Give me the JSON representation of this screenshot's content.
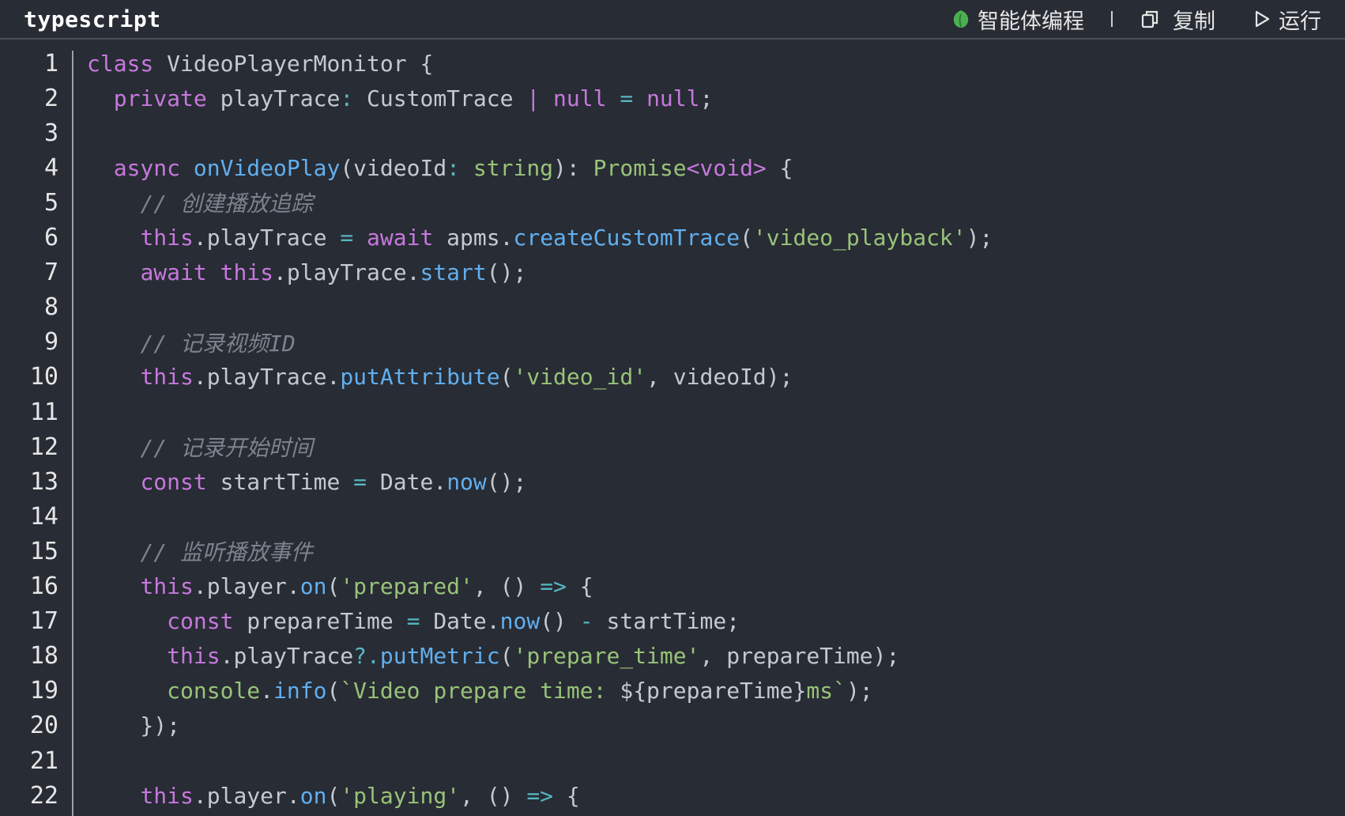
{
  "header": {
    "language": "typescript",
    "agent_label": "智能体编程",
    "copy_label": "复制",
    "run_label": "运行",
    "agent_icon": "leaf-icon",
    "copy_icon": "copy-icon",
    "run_icon": "play-icon"
  },
  "colors": {
    "background": "#282c34",
    "keyword": "#c678dd",
    "function": "#61afef",
    "string": "#98c379",
    "comment": "#7d828c",
    "text": "#c5c9d0",
    "agent_icon": "#4caf50"
  },
  "lines": [
    {
      "n": "1",
      "tokens": [
        [
          "kw",
          "class"
        ],
        [
          "tx",
          " VideoPlayerMonitor {"
        ]
      ]
    },
    {
      "n": "2",
      "tokens": [
        [
          "tx",
          "  "
        ],
        [
          "kw",
          "private"
        ],
        [
          "tx",
          " playTrace"
        ],
        [
          "op",
          ":"
        ],
        [
          "tx",
          " CustomTrace "
        ],
        [
          "kw",
          "|"
        ],
        [
          "tx",
          " "
        ],
        [
          "kw",
          "null"
        ],
        [
          "tx",
          " "
        ],
        [
          "op",
          "="
        ],
        [
          "tx",
          " "
        ],
        [
          "kw",
          "null"
        ],
        [
          "tx",
          ";"
        ]
      ]
    },
    {
      "n": "3",
      "tokens": [
        [
          "tx",
          ""
        ]
      ]
    },
    {
      "n": "4",
      "tokens": [
        [
          "tx",
          "  "
        ],
        [
          "kw",
          "async"
        ],
        [
          "tx",
          " "
        ],
        [
          "fn",
          "onVideoPlay"
        ],
        [
          "tx",
          "(videoId"
        ],
        [
          "op",
          ":"
        ],
        [
          "tx",
          " "
        ],
        [
          "ty",
          "string"
        ],
        [
          "tx",
          "): "
        ],
        [
          "ty",
          "Promise"
        ],
        [
          "kw",
          "<void>"
        ],
        [
          "tx",
          " {"
        ]
      ]
    },
    {
      "n": "5",
      "tokens": [
        [
          "tx",
          "    "
        ],
        [
          "cm",
          "// 创建播放追踪"
        ]
      ]
    },
    {
      "n": "6",
      "tokens": [
        [
          "tx",
          "    "
        ],
        [
          "kw",
          "this"
        ],
        [
          "tx",
          ".playTrace "
        ],
        [
          "op",
          "="
        ],
        [
          "tx",
          " "
        ],
        [
          "kw",
          "await"
        ],
        [
          "tx",
          " apms."
        ],
        [
          "fn",
          "createCustomTrace"
        ],
        [
          "tx",
          "("
        ],
        [
          "str",
          "'video_playback'"
        ],
        [
          "tx",
          ");"
        ]
      ]
    },
    {
      "n": "7",
      "tokens": [
        [
          "tx",
          "    "
        ],
        [
          "kw",
          "await"
        ],
        [
          "tx",
          " "
        ],
        [
          "kw",
          "this"
        ],
        [
          "tx",
          ".playTrace."
        ],
        [
          "fn",
          "start"
        ],
        [
          "tx",
          "();"
        ]
      ]
    },
    {
      "n": "8",
      "tokens": [
        [
          "tx",
          ""
        ]
      ]
    },
    {
      "n": "9",
      "tokens": [
        [
          "tx",
          "    "
        ],
        [
          "cm",
          "// 记录视频ID"
        ]
      ]
    },
    {
      "n": "10",
      "tokens": [
        [
          "tx",
          "    "
        ],
        [
          "kw",
          "this"
        ],
        [
          "tx",
          ".playTrace."
        ],
        [
          "fn",
          "putAttribute"
        ],
        [
          "tx",
          "("
        ],
        [
          "str",
          "'video_id'"
        ],
        [
          "tx",
          ", videoId);"
        ]
      ]
    },
    {
      "n": "11",
      "tokens": [
        [
          "tx",
          ""
        ]
      ]
    },
    {
      "n": "12",
      "tokens": [
        [
          "tx",
          "    "
        ],
        [
          "cm",
          "// 记录开始时间"
        ]
      ]
    },
    {
      "n": "13",
      "tokens": [
        [
          "tx",
          "    "
        ],
        [
          "kw",
          "const"
        ],
        [
          "tx",
          " startTime "
        ],
        [
          "op",
          "="
        ],
        [
          "tx",
          " Date."
        ],
        [
          "fn",
          "now"
        ],
        [
          "tx",
          "();"
        ]
      ]
    },
    {
      "n": "14",
      "tokens": [
        [
          "tx",
          ""
        ]
      ]
    },
    {
      "n": "15",
      "tokens": [
        [
          "tx",
          "    "
        ],
        [
          "cm",
          "// 监听播放事件"
        ]
      ]
    },
    {
      "n": "16",
      "tokens": [
        [
          "tx",
          "    "
        ],
        [
          "kw",
          "this"
        ],
        [
          "tx",
          ".player."
        ],
        [
          "fn",
          "on"
        ],
        [
          "tx",
          "("
        ],
        [
          "str",
          "'prepared'"
        ],
        [
          "tx",
          ", () "
        ],
        [
          "op",
          "=>"
        ],
        [
          "tx",
          " {"
        ]
      ]
    },
    {
      "n": "17",
      "tokens": [
        [
          "tx",
          "      "
        ],
        [
          "kw",
          "const"
        ],
        [
          "tx",
          " prepareTime "
        ],
        [
          "op",
          "="
        ],
        [
          "tx",
          " Date."
        ],
        [
          "fn",
          "now"
        ],
        [
          "tx",
          "() "
        ],
        [
          "op",
          "-"
        ],
        [
          "tx",
          " startTime;"
        ]
      ]
    },
    {
      "n": "18",
      "tokens": [
        [
          "tx",
          "      "
        ],
        [
          "kw",
          "this"
        ],
        [
          "tx",
          ".playTrace"
        ],
        [
          "op",
          "?."
        ],
        [
          "fn",
          "putMetric"
        ],
        [
          "tx",
          "("
        ],
        [
          "str",
          "'prepare_time'"
        ],
        [
          "tx",
          ", prepareTime);"
        ]
      ]
    },
    {
      "n": "19",
      "tokens": [
        [
          "tx",
          "      "
        ],
        [
          "ty",
          "console"
        ],
        [
          "tx",
          "."
        ],
        [
          "fn",
          "info"
        ],
        [
          "tx",
          "("
        ],
        [
          "str",
          "`Video prepare time: "
        ],
        [
          "tx",
          "${prepareTime}"
        ],
        [
          "str",
          "ms`"
        ],
        [
          "tx",
          ");"
        ]
      ]
    },
    {
      "n": "20",
      "tokens": [
        [
          "tx",
          "    });"
        ]
      ]
    },
    {
      "n": "21",
      "tokens": [
        [
          "tx",
          ""
        ]
      ]
    },
    {
      "n": "22",
      "tokens": [
        [
          "tx",
          "    "
        ],
        [
          "kw",
          "this"
        ],
        [
          "tx",
          ".player."
        ],
        [
          "fn",
          "on"
        ],
        [
          "tx",
          "("
        ],
        [
          "str",
          "'playing'"
        ],
        [
          "tx",
          ", () "
        ],
        [
          "op",
          "=>"
        ],
        [
          "tx",
          " {"
        ]
      ]
    }
  ]
}
